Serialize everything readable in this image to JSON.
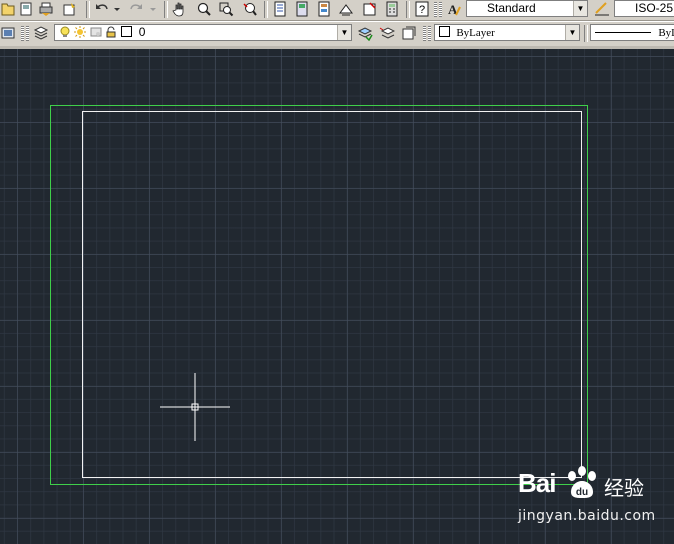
{
  "toolbar_top": {
    "text_style_value": "Standard",
    "dim_style_value": "ISO-25"
  },
  "layers_bar": {
    "layer_value": "0",
    "color_value": "ByLayer",
    "linetype_value": "ByL"
  },
  "colors": {
    "canvas_bg": "#212830",
    "outer_frame": "#3fcf4a",
    "inner_frame": "#f2f2f2"
  },
  "watermark": {
    "brand": "Bai",
    "brand_suffix": "经验",
    "url": "jingyan.baidu.com"
  }
}
